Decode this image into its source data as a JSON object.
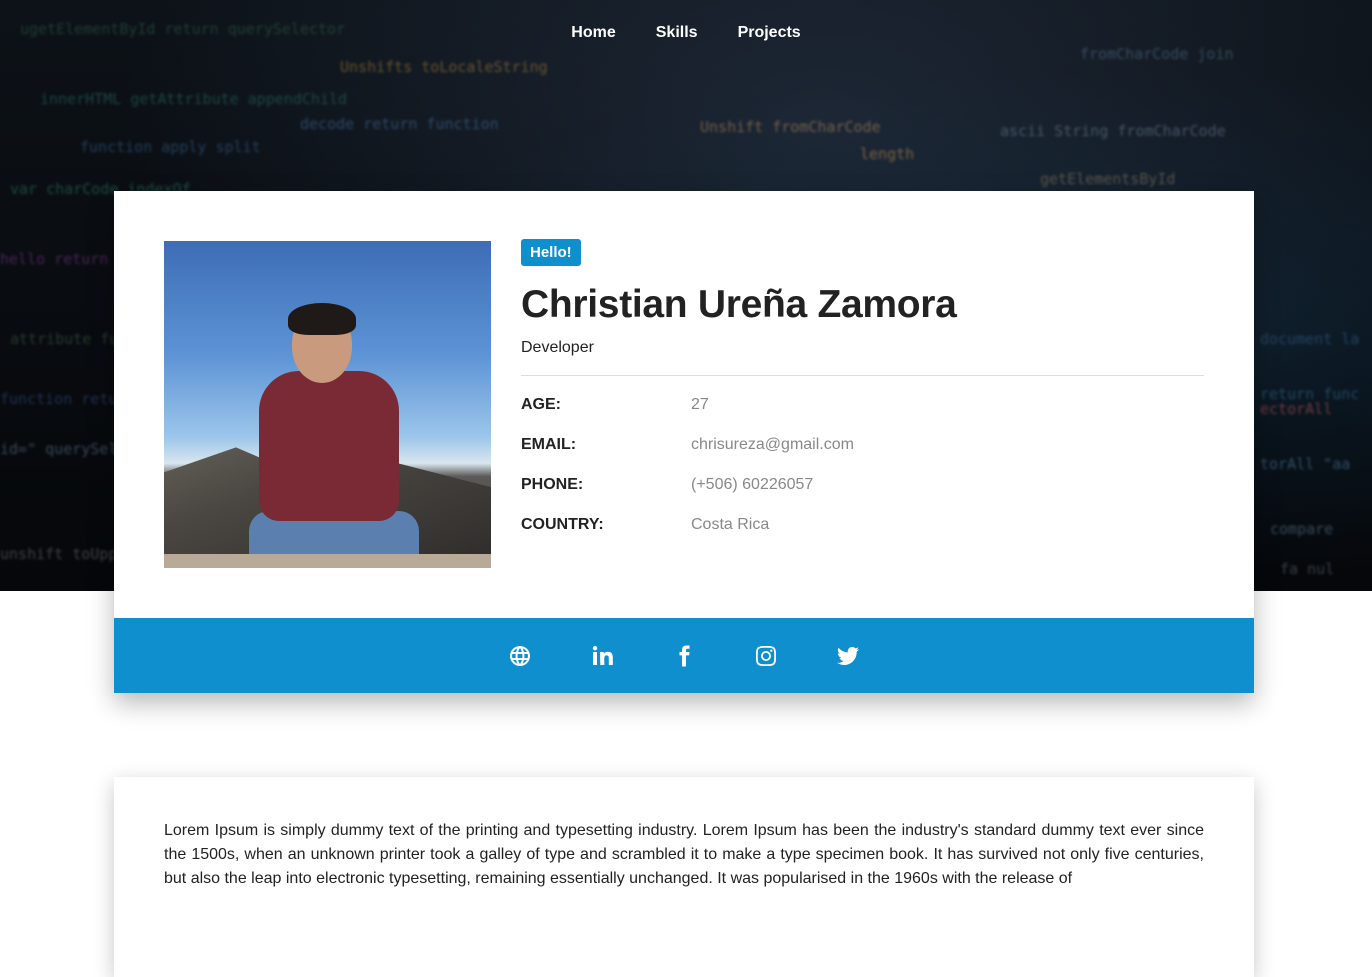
{
  "nav": {
    "items": [
      {
        "label": "Home"
      },
      {
        "label": "Skills"
      },
      {
        "label": "Projects"
      }
    ]
  },
  "profile": {
    "badge": "Hello!",
    "name": "Christian Ureña Zamora",
    "role": "Developer",
    "fields": [
      {
        "label": "AGE:",
        "value": "27"
      },
      {
        "label": "EMAIL:",
        "value": "chrisureza@gmail.com"
      },
      {
        "label": "PHONE:",
        "value": "(+506) 60226057"
      },
      {
        "label": "COUNTRY:",
        "value": "Costa Rica"
      }
    ]
  },
  "social": {
    "icons": [
      "globe-icon",
      "linkedin-icon",
      "facebook-icon",
      "instagram-icon",
      "twitter-icon"
    ]
  },
  "about": {
    "text": "Lorem Ipsum is simply dummy text of the printing and typesetting industry. Lorem Ipsum has been the industry's standard dummy text ever since the 1500s, when an unknown printer took a galley of type and scrambled it to make a type specimen book. It has survived not only five centuries, but also the leap into electronic typesetting, remaining essentially unchanged. It was popularised in the 1960s with the release of"
  },
  "colors": {
    "accent": "#0f8fcd",
    "hero_bg": "#0a0e13"
  }
}
